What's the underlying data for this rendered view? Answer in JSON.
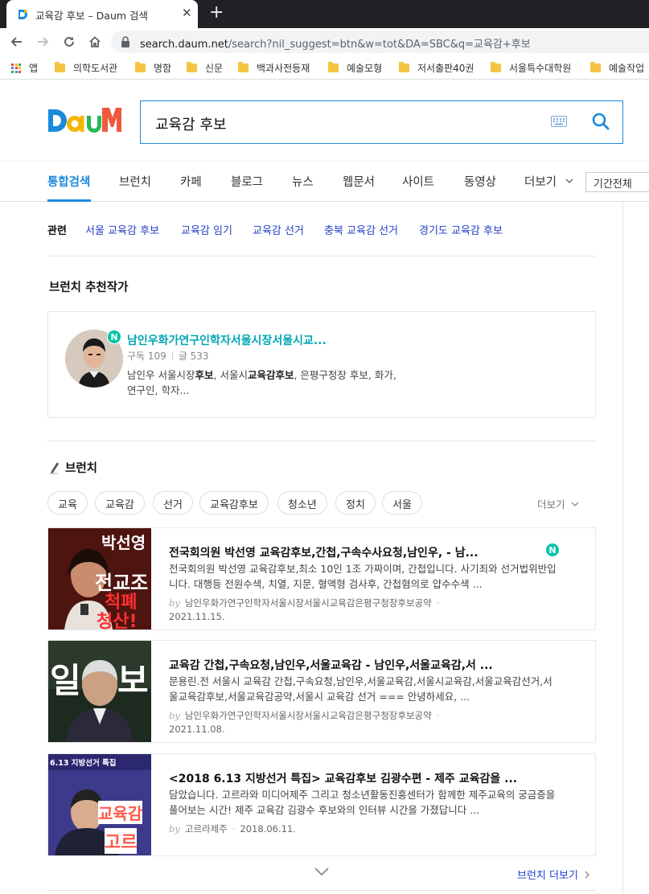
{
  "browser": {
    "tab_title": "교육감 후보 – Daum 검색",
    "url_host": "search.daum.net",
    "url_path": "/search?nil_suggest=btn&w=tot&DA=SBC&q=교육감+후보",
    "bookmarks": [
      "앱",
      "의학도서관",
      "명함",
      "신문",
      "백과사전등재",
      "예술모형",
      "저서출판40권",
      "서울특수대학원",
      "예술작업"
    ]
  },
  "search": {
    "query": "교육감 후보"
  },
  "gnb": {
    "items": [
      "통합검색",
      "브런치",
      "카페",
      "블로그",
      "뉴스",
      "웹문서",
      "사이트",
      "동영상",
      "더보기"
    ],
    "period": "기간전체"
  },
  "related": {
    "label": "관련",
    "links": [
      "서울 교육감 후보",
      "교육감 임기",
      "교육감 선거",
      "충북 교육감 선거",
      "경기도 교육감 후보"
    ]
  },
  "writer_section": {
    "title": "브런치 추천작가",
    "name": "남인우화가연구인학자서울시장서울시교...",
    "subscribers_label": "구독 109",
    "posts_label": "글 533",
    "desc_1": "남인우 서울시장",
    "desc_2": "후보",
    "desc_3": ", 서울시",
    "desc_4": "교육감후보",
    "desc_5": ", 은평구청장 후보, 화가,",
    "desc_6": "연구인, 학자..."
  },
  "brunch": {
    "title": "브런치",
    "tags": [
      "교육",
      "교육감",
      "선거",
      "교육감후보",
      "청소년",
      "정치",
      "서울"
    ],
    "more": "더보기",
    "more_link": "브런치 더보기",
    "posts": [
      {
        "title": "전국회의원 박선영 교육감후보,간첩,구속수사요청,남인우, - 남...",
        "body": "전국회의원 박선영 교육감후보,최소 10인 1조 가짜이며, 간첩입니다. 사기죄와 선거법위반입니다. 대행등 전원수색, 치열, 지문, 혈액형 검사후, 간첩혐의로 얍수수색 ...",
        "author": "남인우화가연구인학자서울시장서울시교육감은평구청장후보공약",
        "date": "2021.11.15.",
        "thumb_text_1": "박선영",
        "thumb_text_2": "전교조",
        "thumb_text_3": "척폐",
        "thumb_text_4": "청산!"
      },
      {
        "title": "교육감 간첩,구속요청,남인우,서울교육감 - 남인우,서울교육감,서 ...",
        "body": "문용린.전 서울시 교육감 간첩,구속요청,남인우,서울교육감,서울시교육감,서울교육감선거,서울교육감후보,서울교육감공약,서울시 교육감 선거 === 안녕하세요, ...",
        "author": "남인우화가연구인학자서울시장서울시교육감은평구청장후보공약",
        "date": "2021.11.08.",
        "thumb_text_1": "일",
        "thumb_text_2": "보"
      },
      {
        "title": "<2018 6.13 지방선거 특집> 교육감후보 김광수편 - 제주 교육감을 ...",
        "body": "담았습니다. 고르라와 미디어제주 그리고 청소년활동진흥센터가 함께한 제주교육의 궁금증을 풀어보는 시간! 제주 교육감 김광수 후보와의 인터뷰 시간을 가졌답니다 ...",
        "author": "고르라제주",
        "date": "2018.06.11.",
        "thumb_text_1": "6.13 지방선거 특집",
        "thumb_text_2": "교육감",
        "thumb_text_3": "고르"
      }
    ]
  }
}
